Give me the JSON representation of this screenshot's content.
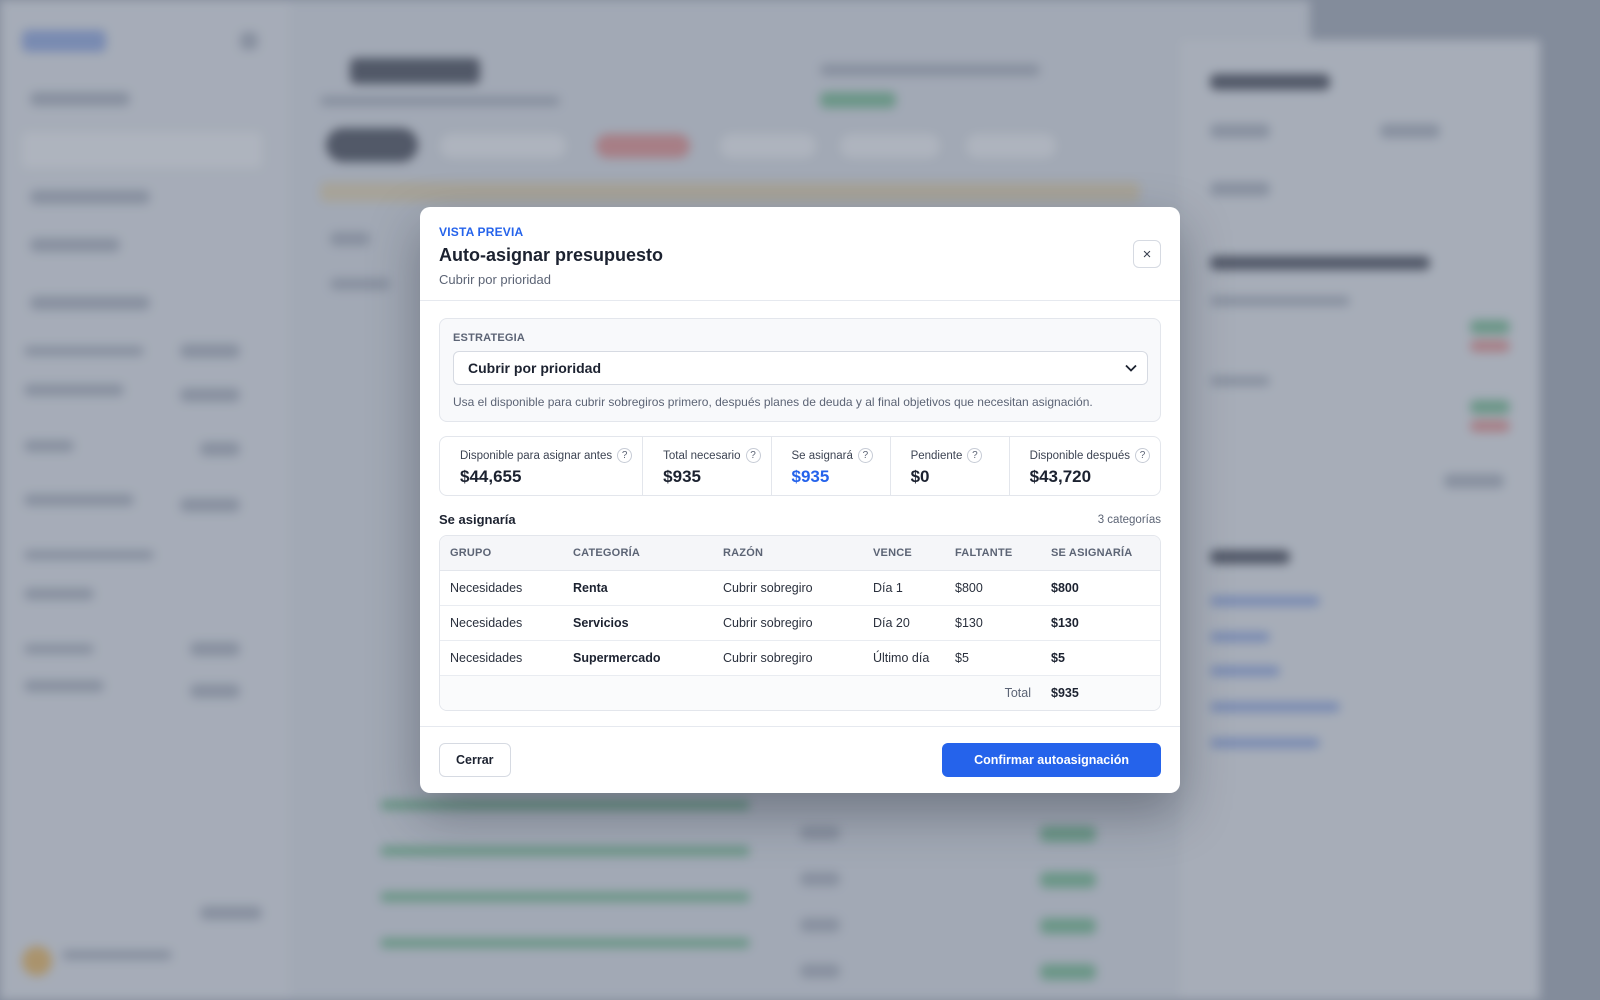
{
  "modal": {
    "eyebrow": "VISTA PREVIA",
    "title": "Auto-asignar presupuesto",
    "subtitle": "Cubrir por prioridad",
    "close_icon": "×",
    "strategy": {
      "label": "ESTRATEGIA",
      "selected": "Cubrir por prioridad",
      "help": "Usa el disponible para cubrir sobregiros primero, después planes de deuda y al final objetivos que necesitan asignación."
    },
    "stats": [
      {
        "label": "Disponible para asignar antes",
        "value": "$44,655"
      },
      {
        "label": "Total necesario",
        "value": "$935"
      },
      {
        "label": "Se asignará",
        "value": "$935"
      },
      {
        "label": "Pendiente",
        "value": "$0"
      },
      {
        "label": "Disponible después",
        "value": "$43,720"
      }
    ],
    "help_glyph": "?",
    "section": {
      "title": "Se asignaría",
      "count": "3 categorías"
    },
    "table": {
      "headers": [
        "GRUPO",
        "CATEGORÍA",
        "RAZÓN",
        "VENCE",
        "FALTANTE",
        "SE ASIGNARÍA"
      ],
      "rows": [
        [
          "Necesidades",
          "Renta",
          "Cubrir sobregiro",
          "Día 1",
          "$800",
          "$800"
        ],
        [
          "Necesidades",
          "Servicios",
          "Cubrir sobregiro",
          "Día 20",
          "$130",
          "$130"
        ],
        [
          "Necesidades",
          "Supermercado",
          "Cubrir sobregiro",
          "Último día",
          "$5",
          "$5"
        ]
      ],
      "total_label": "Total",
      "total_value": "$935"
    },
    "footer": {
      "close_label": "Cerrar",
      "confirm_label": "Confirmar autoasignación"
    }
  },
  "colors": {
    "accent": "#2563eb",
    "text": "#1c2230",
    "muted": "#5c6475"
  },
  "icons": {
    "close": "close-icon",
    "select": "chevron-down-icon",
    "help": "help-circle-icon"
  }
}
